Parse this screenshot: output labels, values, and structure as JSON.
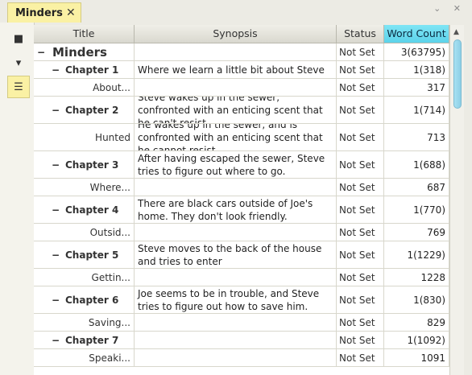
{
  "tab": {
    "title": "Minders",
    "close_glyph": "✕"
  },
  "window_icons": "⌄ ✕",
  "side_tools": [
    {
      "name": "document-icon",
      "glyph": "■"
    },
    {
      "name": "comment-icon",
      "glyph": "▾"
    },
    {
      "name": "outline-icon",
      "glyph": "☰"
    }
  ],
  "columns": [
    "Title",
    "Synopsis",
    "Status",
    "Word Count"
  ],
  "rows": [
    {
      "level": 0,
      "title": "Minders",
      "synopsis": "",
      "status": "Not Set",
      "word_count": "3(63795)"
    },
    {
      "level": 1,
      "title": "Chapter 1",
      "synopsis": "Where we learn a little bit about Steve",
      "status": "Not Set",
      "word_count": "1(318)"
    },
    {
      "level": 2,
      "title": "About...",
      "synopsis": "",
      "status": "Not Set",
      "word_count": "317"
    },
    {
      "level": 1,
      "title": "Chapter 2",
      "synopsis": "Steve wakes up in the sewer, confronted with an enticing scent that he can't resist.",
      "status": "Not Set",
      "word_count": "1(714)"
    },
    {
      "level": 2,
      "title": "Hunted",
      "synopsis": "He wakes up in the sewer, and is confronted with an enticing scent that he cannot resist.",
      "status": "Not Set",
      "word_count": "713"
    },
    {
      "level": 1,
      "title": "Chapter 3",
      "synopsis": "After having escaped the sewer, Steve tries to figure out where to go.",
      "status": "Not Set",
      "word_count": "1(688)"
    },
    {
      "level": 2,
      "title": "Where...",
      "synopsis": "",
      "status": "Not Set",
      "word_count": "687"
    },
    {
      "level": 1,
      "title": "Chapter 4",
      "synopsis": "There are black cars outside of Joe's home. They don't look friendly.",
      "status": "Not Set",
      "word_count": "1(770)"
    },
    {
      "level": 2,
      "title": "Outsid...",
      "synopsis": "",
      "status": "Not Set",
      "word_count": "769"
    },
    {
      "level": 1,
      "title": "Chapter 5",
      "synopsis": "Steve moves to the back of the house and tries to enter",
      "status": "Not Set",
      "word_count": "1(1229)"
    },
    {
      "level": 2,
      "title": "Gettin...",
      "synopsis": "",
      "status": "Not Set",
      "word_count": "1228"
    },
    {
      "level": 1,
      "title": "Chapter 6",
      "synopsis": "Joe seems to be in trouble, and Steve tries to figure out how to save him.",
      "status": "Not Set",
      "word_count": "1(830)"
    },
    {
      "level": 2,
      "title": "Saving...",
      "synopsis": "",
      "status": "Not Set",
      "word_count": "829"
    },
    {
      "level": 1,
      "title": "Chapter 7",
      "synopsis": "",
      "status": "Not Set",
      "word_count": "1(1092)"
    },
    {
      "level": 2,
      "title": "Speaki...",
      "synopsis": "",
      "status": "Not Set",
      "word_count": "1091"
    }
  ]
}
